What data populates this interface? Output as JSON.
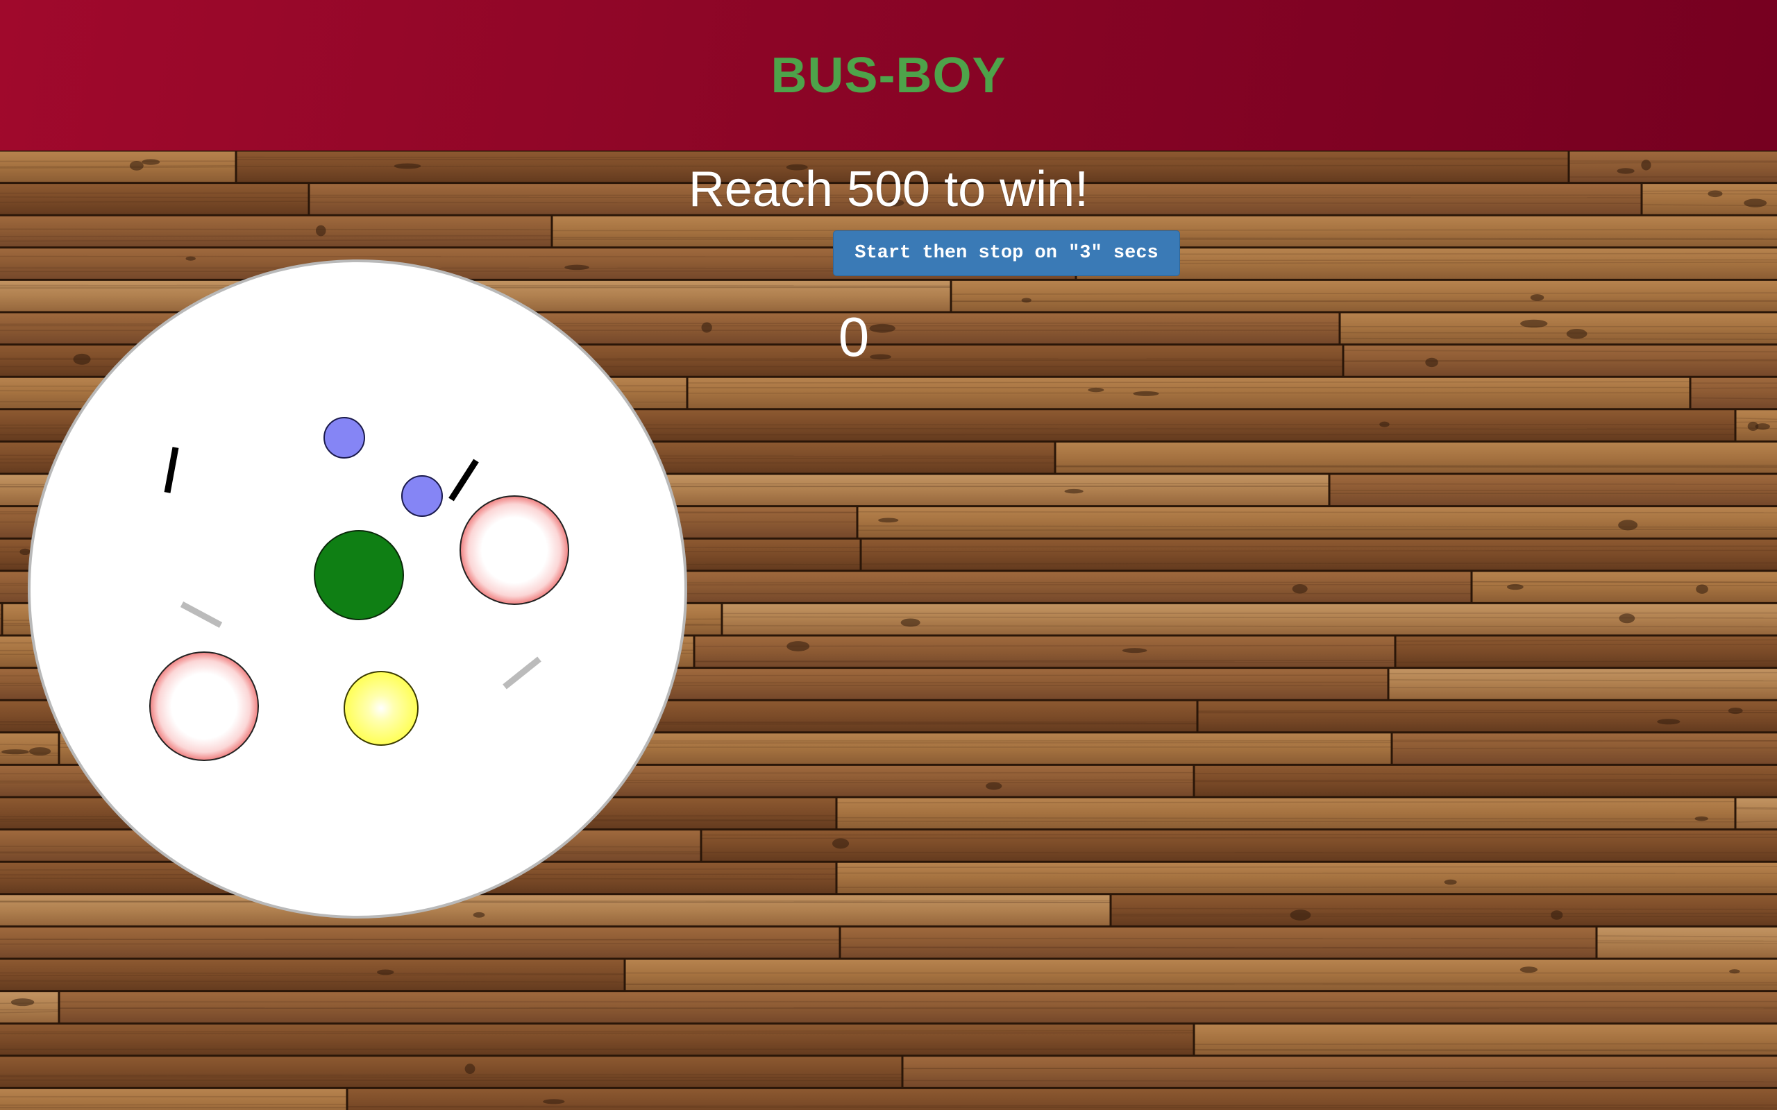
{
  "header": {
    "title": "BUS-BOY"
  },
  "game": {
    "goal_text": "Reach 500 to win!",
    "start_button_label": "Start then stop on \"3\" secs",
    "score": "0"
  },
  "colors": {
    "header_red": "#8b0526",
    "title_green": "#4ea34a",
    "button_blue": "#3a7ab6",
    "table_white": "#ffffff",
    "plate_pink": "#f08080",
    "cup_blue": "#8585f5",
    "green_item": "#0f7f14",
    "yellow_item": "#ffff66"
  },
  "table_items": [
    {
      "type": "cup",
      "color": "#8585f5",
      "icon": "blue-cup-icon"
    },
    {
      "type": "cup",
      "color": "#8585f5",
      "icon": "blue-cup-icon"
    },
    {
      "type": "plate",
      "color": "#f08080",
      "icon": "plate-icon"
    },
    {
      "type": "plate",
      "color": "#f08080",
      "icon": "plate-icon"
    },
    {
      "type": "food",
      "color": "#0f7f14",
      "icon": "green-food-icon"
    },
    {
      "type": "food",
      "color": "#ffff66",
      "icon": "yellow-food-icon"
    },
    {
      "type": "utensil",
      "color": "#000000",
      "icon": "black-utensil-icon"
    },
    {
      "type": "utensil",
      "color": "#000000",
      "icon": "black-utensil-icon"
    },
    {
      "type": "utensil",
      "color": "#bbbbbb",
      "icon": "gray-utensil-icon"
    },
    {
      "type": "utensil",
      "color": "#bbbbbb",
      "icon": "gray-utensil-icon"
    }
  ]
}
